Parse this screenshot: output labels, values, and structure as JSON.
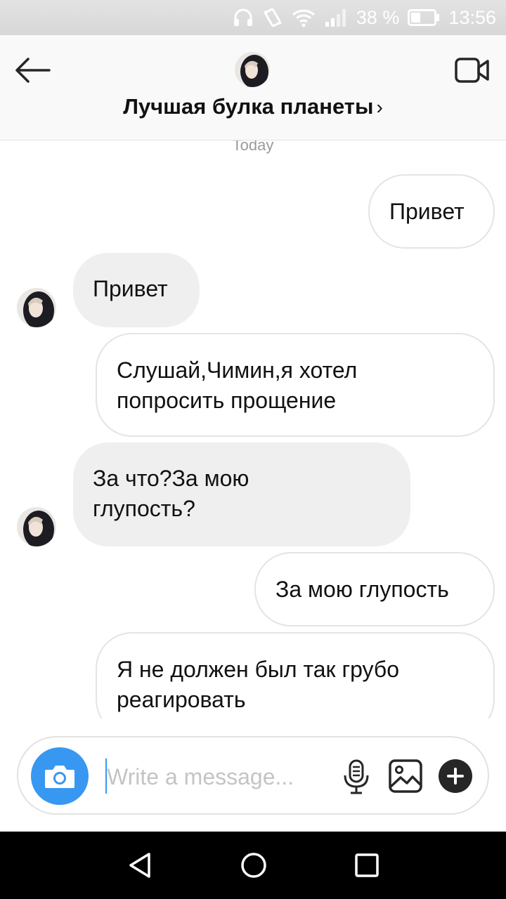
{
  "status_bar": {
    "battery": "38 %",
    "time": "13:56",
    "icons": [
      "headphones-icon",
      "vibrate-icon",
      "wifi-icon",
      "signal-icon",
      "battery-icon"
    ]
  },
  "header": {
    "title": "Лучшая булка планеты",
    "chevron": "›",
    "icons": [
      "back-arrow-icon",
      "video-call-icon"
    ]
  },
  "chat": {
    "day_separator": "Today",
    "messages": [
      {
        "direction": "outgoing",
        "lines": [
          "Привет"
        ]
      },
      {
        "direction": "incoming",
        "lines": [
          "Привет"
        ]
      },
      {
        "direction": "outgoing",
        "lines": [
          "Слушай,Чимин,я хотел",
          "попросить прощение"
        ]
      },
      {
        "direction": "incoming",
        "lines": [
          "За что?За мою",
          "глупость?"
        ]
      },
      {
        "direction": "outgoing",
        "lines": [
          "За мою глупость"
        ]
      },
      {
        "direction": "outgoing",
        "lines": [
          "Я не должен был так грубо",
          "реагировать"
        ]
      }
    ]
  },
  "composer": {
    "placeholder": "Write a message...",
    "value": "",
    "icons": [
      "camera-icon",
      "microphone-icon",
      "gallery-icon",
      "plus-icon"
    ],
    "accent_color": "#3897f0"
  },
  "nav_bar": {
    "icons": [
      "back-triangle-icon",
      "home-circle-icon",
      "recents-square-icon"
    ]
  }
}
